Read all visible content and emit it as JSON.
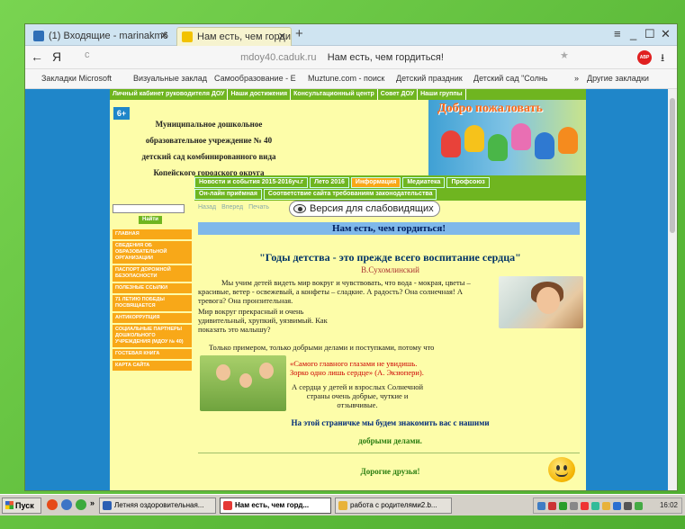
{
  "browser": {
    "tabs": [
      {
        "label": "(1) Входящие - marinakm6"
      },
      {
        "label": "Нам есть, чем гордить"
      }
    ],
    "new_tab": "+",
    "window_controls": [
      "≡",
      "_",
      "☐",
      "✕"
    ],
    "back": "←",
    "home": "Я",
    "reload": "c",
    "url_domain": "mdoy40.caduk.ru",
    "url_title": "Нам есть, чем гордиться!",
    "adblock": "ABP",
    "download": "⭳",
    "bookmarks": [
      "Закладки Microsoft",
      "Визуальные заклад",
      "Самообразование - Е",
      "Muztune.com - поиск",
      "Детский праздник",
      "Детский сад \"Солнь",
      "»",
      "Другие закладки"
    ]
  },
  "site": {
    "top_nav": [
      "Личный кабинет руководителя ДОУ",
      "Наши достижения",
      "Консультационный центр",
      "Совет ДОУ",
      "Наши группы"
    ],
    "age_badge": "6+",
    "institution_lines": [
      "Муниципальное дошкольное",
      "образовательное учреждение № 40",
      "детский сад комбинированного вида",
      "Копейского городского округа"
    ],
    "banner_title": "Добро пожаловать",
    "sub_nav_row1": [
      "Новости и события 2015-2016уч.г",
      "Лето 2016",
      "Информация",
      "Медиатека",
      "Профсоюз"
    ],
    "sub_nav_row2": [
      "Он-лайн приёмная",
      "Соответствие сайта требованиям законодательства"
    ],
    "search_button": "Найти",
    "side_menu": [
      "Главная",
      "Сведения об образовательной организации",
      "Паспорт дорожной безопасности",
      "Полезные ссылки",
      "71 летию Победы посвящается",
      "Антикоррупция",
      "Социальные партнеры дошкольного учреждения (МДОУ № 40)",
      "Гостевая книга",
      "Карта сайта"
    ],
    "toolbar": [
      "Назад",
      "Вперед",
      "Печать"
    ],
    "vision_button": "Версия для слабовидящих",
    "page_title": "Нам есть, чем гордиться!",
    "quote": "\"Годы детства - это прежде всего воспитание сердца\"",
    "quote_author": "В.Сухомлинский",
    "paragraph1": "Мы  учим детей видеть мир вокруг и чувствовать, что вода - мокрая, цветы – красивые, ветер - освежевый, а  конфеты – сладкие.  А радость? Она солнечная! А тревога? Она пронзительная.",
    "paragraph2": "Мир вокруг прекрасный и очень удивительный, хрупкий, уязвимый. Как показать это малышу?",
    "paragraph3": "Только примером, только добрыми делами и поступками, потому что",
    "paragraph4": "«Самого главного глазами не увидишь. Зорко одно лишь сердце» (А. Экзюпери).",
    "paragraph5": "А сердца у детей и взрослых  Солнечной  страны очень добрые, чуткие  и отзывчивые.",
    "info_line": "На этой страничке мы будем знакомить вас с нашими",
    "info_line2": "добрыми делами.",
    "friends": "Дорогие друзья!"
  },
  "taskbar": {
    "start": "Пуск",
    "quicklaunch_more": "»",
    "tasks": [
      "Летняя оздоровительная...",
      "Нам есть, чем горд...",
      "работа с родителями2.b..."
    ],
    "clock": "16:02"
  }
}
